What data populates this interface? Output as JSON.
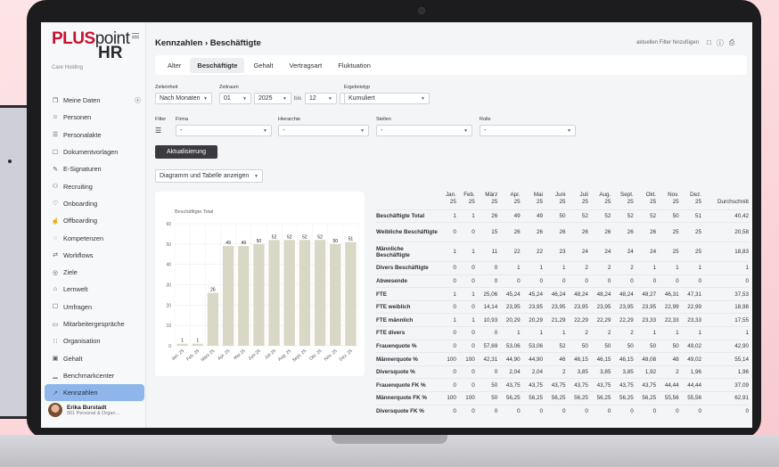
{
  "app": {
    "logo_brand": "PLUS",
    "logo_point": "point",
    "logo_hr": "HR",
    "company": "Care Holding"
  },
  "sidebar": {
    "items": [
      {
        "label": "Meine Daten",
        "icon": "folder-icon"
      },
      {
        "label": "Personen",
        "icon": "people-icon"
      },
      {
        "label": "Personalakte",
        "icon": "file-icon"
      },
      {
        "label": "Dokumentvorlagen",
        "icon": "template-icon"
      },
      {
        "label": "E-Signaturen",
        "icon": "pen-icon"
      },
      {
        "label": "Recruiting",
        "icon": "recruiting-icon"
      },
      {
        "label": "Onboarding",
        "icon": "handshake-icon"
      },
      {
        "label": "Offboarding",
        "icon": "hand-icon"
      },
      {
        "label": "Kompetenzen",
        "icon": "bulb-icon"
      },
      {
        "label": "Workflows",
        "icon": "workflow-icon"
      },
      {
        "label": "Ziele",
        "icon": "target-icon"
      },
      {
        "label": "Lernwelt",
        "icon": "graduation-icon"
      },
      {
        "label": "Umfragen",
        "icon": "survey-icon"
      },
      {
        "label": "Mitarbeitergespräche",
        "icon": "chat-icon"
      },
      {
        "label": "Organisation",
        "icon": "org-icon"
      },
      {
        "label": "Gehalt",
        "icon": "money-icon"
      },
      {
        "label": "Benchmarkcenter",
        "icon": "bar-chart-icon"
      },
      {
        "label": "Kennzahlen",
        "icon": "line-chart-icon",
        "active": true
      }
    ],
    "user_name": "Erika Burstadt",
    "user_role": "001 Personal & Organ..."
  },
  "header": {
    "breadcrumb": "Kennzahlen › Beschäftigte",
    "filter_link": "aktuellen Filter hinzufügen"
  },
  "tabs": [
    "Alter",
    "Beschäftigte",
    "Gehalt",
    "Vertragsart",
    "Fluktuation"
  ],
  "active_tab": "Beschäftigte",
  "filters": {
    "zeiteinheit_label": "Zeiteinheit",
    "zeiteinheit_value": "Nach Monaten",
    "zeitraum_label": "Zeitraum",
    "from_month": "01",
    "from_year": "2025",
    "bis": "bis",
    "to_month": "12",
    "to_year": "2025",
    "ergebnistyp_label": "Ergebnistyp",
    "ergebnistyp_value": "Kumuliert",
    "filter_label": "Filter",
    "firma_label": "Firma",
    "hierarchie_label": "Hierarchie",
    "stellen_label": "Stellen",
    "rolle_label": "Rolle",
    "empty_value": "-"
  },
  "buttons": {
    "update": "Aktualisierung",
    "view_mode": "Diagramm und Tabelle anzeigen"
  },
  "chart_data": {
    "type": "bar",
    "title": "Beschäftigte Total",
    "categories": [
      "Jan. 25",
      "Feb. 25",
      "März 25",
      "Apr. 25",
      "Mai 25",
      "Juni 25",
      "Juli 25",
      "Aug. 25",
      "Sept. 25",
      "Okt. 25",
      "Nov. 25",
      "Dez. 25"
    ],
    "values": [
      1,
      1,
      26,
      49,
      49,
      50,
      52,
      52,
      52,
      52,
      50,
      51
    ],
    "ylim": [
      0,
      60
    ],
    "yticks": [
      0,
      10,
      20,
      30,
      40,
      50,
      60
    ],
    "bar_color": "#d9d8c6",
    "grid": true
  },
  "table": {
    "months": [
      [
        "Jan.",
        "25"
      ],
      [
        "Feb.",
        "25"
      ],
      [
        "März",
        "25"
      ],
      [
        "Apr.",
        "25"
      ],
      [
        "Mai",
        "25"
      ],
      [
        "Juni",
        "25"
      ],
      [
        "Juli",
        "25"
      ],
      [
        "Aug.",
        "25"
      ],
      [
        "Sept.",
        "25"
      ],
      [
        "Okt.",
        "25"
      ],
      [
        "Nov.",
        "25"
      ],
      [
        "Dez.",
        "25"
      ]
    ],
    "avg_header": "Durchschnitt",
    "rows": [
      {
        "label": "Beschäftigte Total",
        "values": [
          "1",
          "1",
          "26",
          "49",
          "49",
          "50",
          "52",
          "52",
          "52",
          "52",
          "50",
          "51",
          "40,42"
        ]
      },
      {
        "label": "Weibliche Beschäftigte",
        "values": [
          "0",
          "0",
          "15",
          "26",
          "26",
          "26",
          "26",
          "26",
          "26",
          "26",
          "25",
          "25",
          "20,58"
        ]
      },
      {
        "label": "Männliche Beschäftigte",
        "values": [
          "1",
          "1",
          "11",
          "22",
          "22",
          "23",
          "24",
          "24",
          "24",
          "24",
          "25",
          "25",
          "18,83"
        ]
      },
      {
        "label": "Divers Beschäftigte",
        "values": [
          "0",
          "0",
          "0",
          "1",
          "1",
          "1",
          "2",
          "2",
          "2",
          "1",
          "1",
          "1",
          "1"
        ]
      },
      {
        "label": "Abwesende",
        "values": [
          "0",
          "0",
          "0",
          "0",
          "0",
          "0",
          "0",
          "0",
          "0",
          "0",
          "0",
          "0",
          "0"
        ]
      },
      {
        "label": "FTE",
        "values": [
          "1",
          "1",
          "25,06",
          "45,24",
          "45,24",
          "46,24",
          "48,24",
          "48,24",
          "48,24",
          "48,27",
          "46,31",
          "47,31",
          "37,53"
        ]
      },
      {
        "label": "FTE weiblich",
        "values": [
          "0",
          "0",
          "14,14",
          "23,95",
          "23,95",
          "23,95",
          "23,95",
          "23,95",
          "23,95",
          "23,95",
          "22,99",
          "22,99",
          "18,98"
        ]
      },
      {
        "label": "FTE männlich",
        "values": [
          "1",
          "1",
          "10,93",
          "20,29",
          "20,29",
          "21,29",
          "22,29",
          "22,29",
          "22,29",
          "23,33",
          "22,33",
          "23,33",
          "17,55"
        ]
      },
      {
        "label": "FTE divers",
        "values": [
          "0",
          "0",
          "0",
          "1",
          "1",
          "1",
          "2",
          "2",
          "2",
          "1",
          "1",
          "1",
          "1"
        ]
      },
      {
        "label": "Frauenquote %",
        "values": [
          "0",
          "0",
          "57,69",
          "53,06",
          "53,06",
          "52",
          "50",
          "50",
          "50",
          "50",
          "50",
          "49,02",
          "42,90"
        ]
      },
      {
        "label": "Männerquote %",
        "values": [
          "100",
          "100",
          "42,31",
          "44,90",
          "44,90",
          "46",
          "46,15",
          "46,15",
          "46,15",
          "48,08",
          "48",
          "49,02",
          "55,14"
        ]
      },
      {
        "label": "Diversquote %",
        "values": [
          "0",
          "0",
          "0",
          "2,04",
          "2,04",
          "2",
          "3,85",
          "3,85",
          "3,85",
          "1,92",
          "2",
          "1,96",
          "1,96"
        ]
      },
      {
        "label": "Frauenquote FK %",
        "values": [
          "0",
          "0",
          "50",
          "43,75",
          "43,75",
          "43,75",
          "43,75",
          "43,75",
          "43,75",
          "43,75",
          "44,44",
          "44,44",
          "37,09"
        ]
      },
      {
        "label": "Männerquote FK %",
        "values": [
          "100",
          "100",
          "50",
          "56,25",
          "56,25",
          "56,25",
          "56,25",
          "56,25",
          "56,25",
          "56,25",
          "55,56",
          "55,56",
          "62,91"
        ]
      },
      {
        "label": "Diversquote FK %",
        "values": [
          "0",
          "0",
          "0",
          "0",
          "0",
          "0",
          "0",
          "0",
          "0",
          "0",
          "0",
          "0",
          "0"
        ]
      }
    ]
  }
}
